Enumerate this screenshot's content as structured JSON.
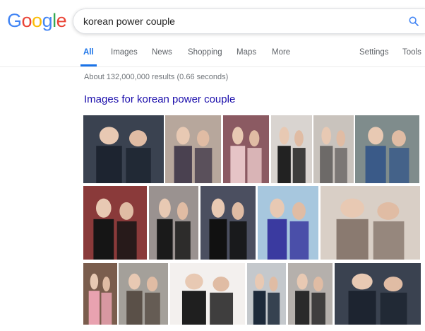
{
  "logo": {
    "letters": [
      "G",
      "o",
      "o",
      "g",
      "l",
      "e"
    ],
    "colors": [
      "#4285f4",
      "#ea4335",
      "#fbbc05",
      "#4285f4",
      "#34a853",
      "#ea4335"
    ]
  },
  "search": {
    "query": "korean power couple",
    "icon": "search-icon"
  },
  "tabs": [
    {
      "label": "All",
      "active": true
    },
    {
      "label": "Images"
    },
    {
      "label": "News"
    },
    {
      "label": "Shopping"
    },
    {
      "label": "Maps"
    },
    {
      "label": "More"
    },
    {
      "label": "Settings"
    },
    {
      "label": "Tools"
    }
  ],
  "stats": "About 132,000,000 results (0.66 seconds)",
  "images_heading": "Images for korean power couple",
  "thumbnails": [
    {
      "bg": "#3a4250",
      "accent": "#1d2430"
    },
    {
      "bg": "#b7a79c",
      "accent": "#4a4150"
    },
    {
      "bg": "#8b5a62",
      "accent": "#e6c4c6"
    },
    {
      "bg": "#d9d4d0",
      "accent": "#222222"
    },
    {
      "bg": "#c9c3bd",
      "accent": "#6d6a68"
    },
    {
      "bg": "#7f8c8c",
      "accent": "#3a5a88"
    },
    {
      "bg": "#8a3a3a",
      "accent": "#151515"
    },
    {
      "bg": "#9a9290",
      "accent": "#1a1a1a"
    },
    {
      "bg": "#4b4f60",
      "accent": "#111111"
    },
    {
      "bg": "#a7c7de",
      "accent": "#3a3aa0"
    },
    {
      "bg": "#d9cfc6",
      "accent": "#8a7a70"
    },
    {
      "bg": "#7a5d4d",
      "accent": "#e9a2b0"
    },
    {
      "bg": "#a4a09a",
      "accent": "#5a5048"
    },
    {
      "bg": "#f3f0ee",
      "accent": "#1f1f1f"
    },
    {
      "bg": "#c4c8cc",
      "accent": "#1d2a3a"
    },
    {
      "bg": "#b5b0ac",
      "accent": "#2a2a2a"
    }
  ]
}
